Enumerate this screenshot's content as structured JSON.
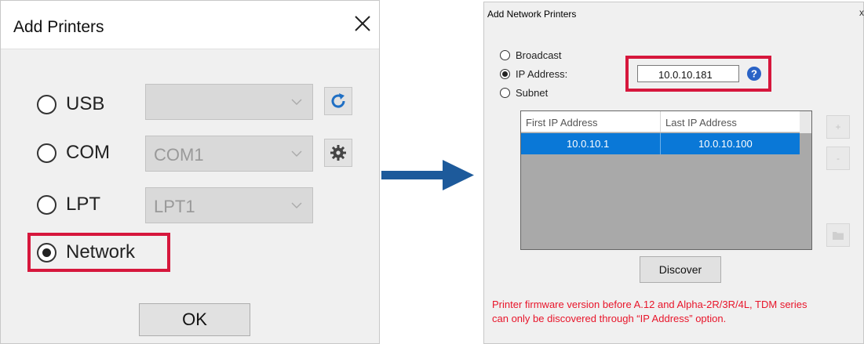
{
  "add_printers": {
    "title": "Add Printers",
    "options": [
      {
        "label": "USB",
        "selected": false,
        "combo_value": "",
        "button_icon": "refresh-icon"
      },
      {
        "label": "COM",
        "selected": false,
        "combo_value": "COM1",
        "button_icon": "gear-icon"
      },
      {
        "label": "LPT",
        "selected": false,
        "combo_value": "LPT1"
      },
      {
        "label": "Network",
        "selected": true
      }
    ],
    "ok_label": "OK"
  },
  "network_dialog": {
    "title": "Add Network Printers",
    "options": [
      {
        "label": "Broadcast",
        "selected": false
      },
      {
        "label": "IP Address:",
        "selected": true
      },
      {
        "label": "Subnet",
        "selected": false
      }
    ],
    "ip_value": "10.0.10.181",
    "table": {
      "columns": [
        "First IP Address",
        "Last IP Address"
      ],
      "rows": [
        [
          "10.0.10.1",
          "10.0.10.100"
        ]
      ]
    },
    "side_buttons": [
      "+",
      "-"
    ],
    "discover_label": "Discover",
    "warning_lines": [
      "Printer firmware version before A.12 and Alpha-2R/3R/4L, TDM series",
      "can only be discovered through “IP Address” option."
    ]
  },
  "colors": {
    "highlight": "#d6173c",
    "arrow": "#1d5a9b",
    "selection": "#0a78d7",
    "warning": "#e8152a",
    "refresh_icon": "#1f6fc4",
    "help_icon": "#2a63c6"
  }
}
